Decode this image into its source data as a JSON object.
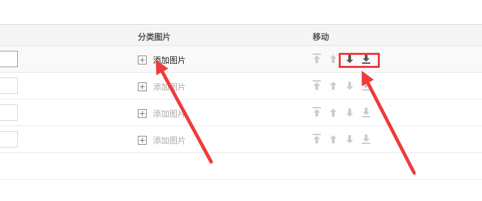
{
  "header": {
    "col_image": "分类图片",
    "col_move": "移动"
  },
  "rows": [
    {
      "add_image_label": "添加图片",
      "active": true
    },
    {
      "add_image_label": "添加图片",
      "active": false
    },
    {
      "add_image_label": "添加图片",
      "active": false
    },
    {
      "add_image_label": "添加图片",
      "active": false
    }
  ],
  "move_icons": [
    "move-top-icon",
    "move-up-icon",
    "move-down-icon",
    "move-bottom-icon"
  ],
  "colors": {
    "annotation": "#ef3b3b",
    "icon_active": "#555555",
    "icon_disabled": "#cccccc"
  }
}
